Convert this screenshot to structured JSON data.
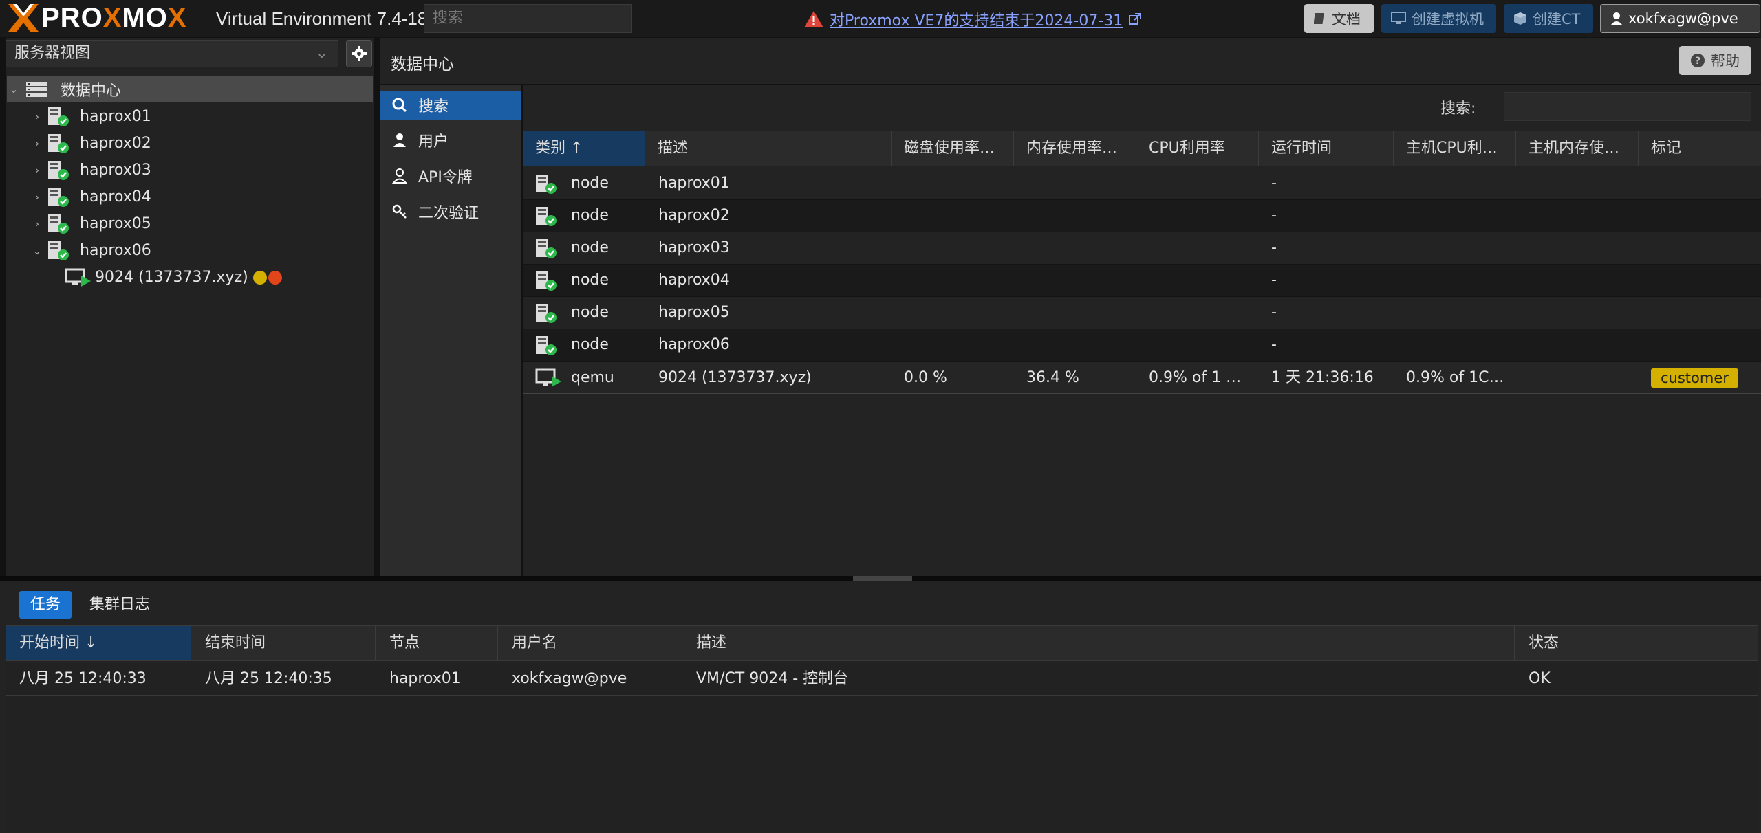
{
  "header": {
    "logo_text_a": "PRO",
    "logo_text_x": "X",
    "logo_text_b": "MO",
    "logo_text_c": "X",
    "version": "Virtual Environment 7.4-18",
    "search_placeholder": "搜索",
    "notice": "对Proxmox VE7的支持结束于2024-07-31",
    "docs_label": "文档",
    "create_vm_label": "创建虚拟机",
    "create_ct_label": "创建CT",
    "user_label": "xokfxagw@pve"
  },
  "sidebar": {
    "view": "服务器视图",
    "datacenter": "数据中心",
    "nodes": [
      "haprox01",
      "haprox02",
      "haprox03",
      "haprox04",
      "haprox05",
      "haprox06"
    ],
    "vm": "9024 (1373737.xyz)"
  },
  "main": {
    "title": "数据中心",
    "help_label": "帮助",
    "nav": [
      "搜索",
      "用户",
      "API令牌",
      "二次验证"
    ],
    "search_label": "搜索:",
    "columns": [
      "类别",
      "描述",
      "磁盘使用率…",
      "内存使用率…",
      "CPU利用率",
      "运行时间",
      "主机CPU利…",
      "主机内存使…",
      "标记"
    ],
    "rows": [
      {
        "type": "node",
        "desc": "haprox01",
        "disk": "",
        "mem": "",
        "cpu": "",
        "uptime": "-",
        "hcpu": "",
        "hmem": "",
        "tag": ""
      },
      {
        "type": "node",
        "desc": "haprox02",
        "disk": "",
        "mem": "",
        "cpu": "",
        "uptime": "-",
        "hcpu": "",
        "hmem": "",
        "tag": ""
      },
      {
        "type": "node",
        "desc": "haprox03",
        "disk": "",
        "mem": "",
        "cpu": "",
        "uptime": "-",
        "hcpu": "",
        "hmem": "",
        "tag": ""
      },
      {
        "type": "node",
        "desc": "haprox04",
        "disk": "",
        "mem": "",
        "cpu": "",
        "uptime": "-",
        "hcpu": "",
        "hmem": "",
        "tag": ""
      },
      {
        "type": "node",
        "desc": "haprox05",
        "disk": "",
        "mem": "",
        "cpu": "",
        "uptime": "-",
        "hcpu": "",
        "hmem": "",
        "tag": ""
      },
      {
        "type": "node",
        "desc": "haprox06",
        "disk": "",
        "mem": "",
        "cpu": "",
        "uptime": "-",
        "hcpu": "",
        "hmem": "",
        "tag": ""
      },
      {
        "type": "qemu",
        "desc": "9024 (1373737.xyz)",
        "disk": "0.0 %",
        "mem": "36.4 %",
        "cpu": "0.9% of 1 …",
        "uptime": "1 天 21:36:16",
        "hcpu": "0.9% of 1C…",
        "hmem": "",
        "tag": "customer"
      }
    ]
  },
  "tasks": {
    "tabs": [
      "任务",
      "集群日志"
    ],
    "columns": [
      "开始时间",
      "结束时间",
      "节点",
      "用户名",
      "描述",
      "状态"
    ],
    "row": {
      "start": "八月 25 12:40:33",
      "end": "八月 25 12:40:35",
      "node": "haprox01",
      "user": "xokfxagw@pve",
      "desc": "VM/CT 9024 - 控制台",
      "status": "OK"
    }
  },
  "colors": {
    "accent": "#1b5ea6",
    "brand_orange": "#e57000",
    "ok_green": "#2db84c",
    "tag_yellow": "#d4b000"
  }
}
